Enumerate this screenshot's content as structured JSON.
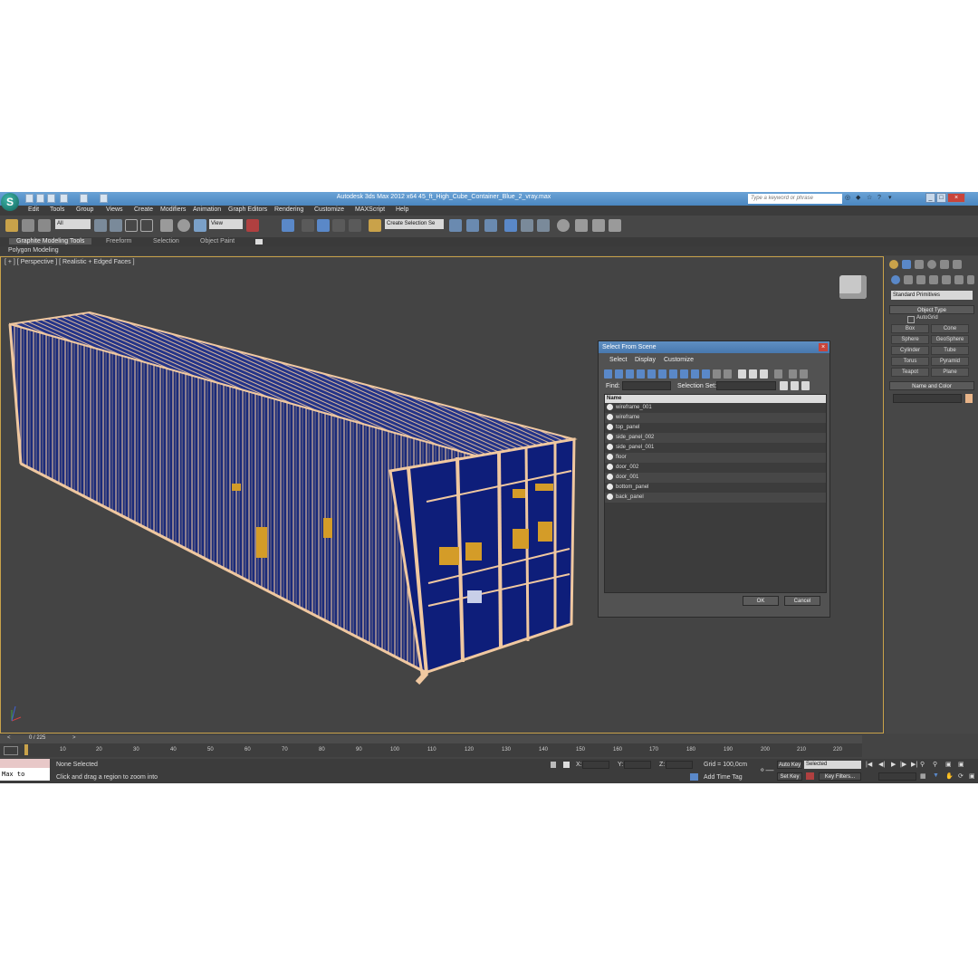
{
  "window": {
    "title": "Autodesk 3ds Max  2012 x64      45_ft_High_Cube_Container_Blue_2_vray.max",
    "search_placeholder": "Type a keyword or phrase"
  },
  "menu": [
    "Edit",
    "Tools",
    "Group",
    "Views",
    "Create",
    "Modifiers",
    "Animation",
    "Graph Editors",
    "Rendering",
    "Customize",
    "MAXScript",
    "Help"
  ],
  "toolbar": {
    "filter": "All",
    "ref_coord": "View",
    "selection_set": "Create Selection Se"
  },
  "ribbon": {
    "tabs": [
      "Graphite Modeling Tools",
      "Freeform",
      "Selection",
      "Object Paint"
    ],
    "sub": "Polygon Modeling"
  },
  "viewport": {
    "label": "[ + ] [ Perspective ] [ Realistic + Edged Faces ]"
  },
  "command_panel": {
    "dropdown": "Standard Primitives",
    "object_type": "Object Type",
    "autogrid": "AutoGrid",
    "buttons": [
      "Box",
      "Cone",
      "Sphere",
      "GeoSphere",
      "Cylinder",
      "Tube",
      "Torus",
      "Pyramid",
      "Teapot",
      "Plane"
    ],
    "name_color": "Name and Color",
    "color": "#e8b488"
  },
  "dialog": {
    "title": "Select From Scene",
    "menu": [
      "Select",
      "Display",
      "Customize"
    ],
    "find_label": "Find:",
    "selset_label": "Selection Set:",
    "column": "Name",
    "items": [
      "wireframe_001",
      "wireframe",
      "top_panel",
      "side_panel_002",
      "side_panel_001",
      "floor",
      "door_002",
      "door_001",
      "bottom_panel",
      "back_panel"
    ],
    "ok": "OK",
    "cancel": "Cancel"
  },
  "timeline": {
    "frame": "0 / 225",
    "ticks": [
      "10",
      "20",
      "30",
      "40",
      "50",
      "60",
      "70",
      "80",
      "90",
      "100",
      "110",
      "120",
      "130",
      "140",
      "150",
      "160",
      "170",
      "180",
      "190",
      "200",
      "210",
      "220"
    ]
  },
  "status": {
    "script": "Max to Physc.",
    "selected": "None Selected",
    "prompt": "Click and drag a region to zoom into",
    "x": "X:",
    "y": "Y:",
    "z": "Z:",
    "grid": "Grid = 100,0cm",
    "add_time_tag": "Add Time Tag",
    "auto_key": "Auto Key",
    "set_key": "Set Key",
    "key_mode": "Selected",
    "key_filters": "Key Filters..."
  },
  "colors": {
    "container": "#0e1e7a",
    "wire": "#f0c8a0",
    "accent": "#4a86c0"
  }
}
